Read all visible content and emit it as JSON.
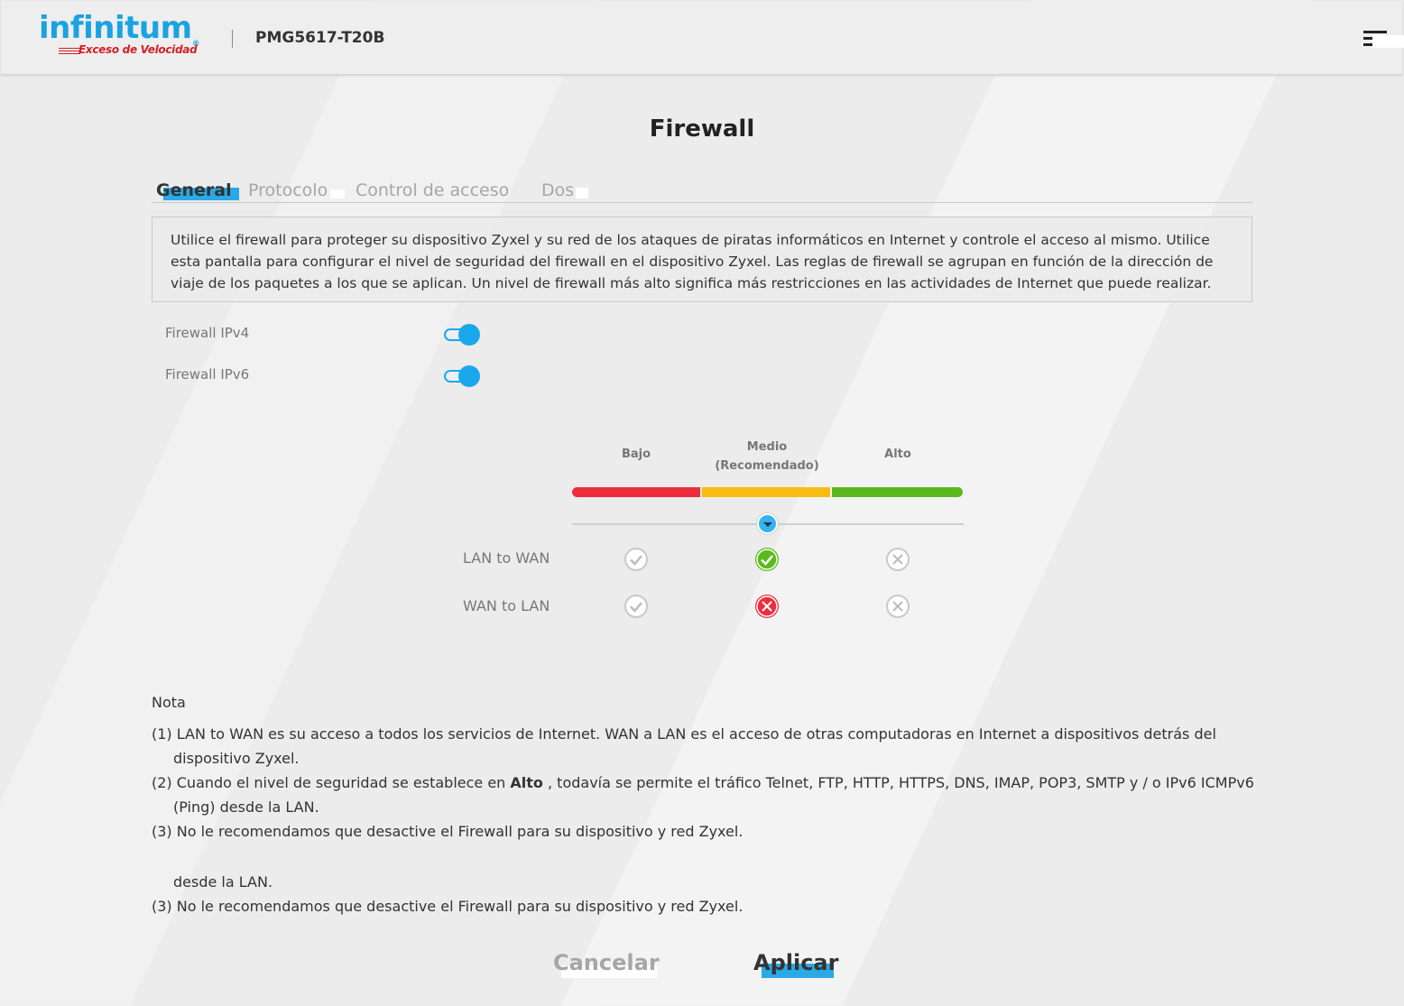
{
  "header": {
    "logo_main": "infinitum",
    "logo_reg": "®",
    "logo_sub": "Exceso de Velocidad",
    "model": "PMG5617-T20B"
  },
  "page": {
    "title": "Firewall"
  },
  "tabs": [
    {
      "label": "General",
      "active": true
    },
    {
      "label": "Protocolo",
      "active": false
    },
    {
      "label": "Control de acceso",
      "active": false
    },
    {
      "label": "Dos",
      "active": false
    }
  ],
  "description": "Utilice el firewall para proteger su dispositivo Zyxel y su red de los ataques de piratas informáticos en Internet y controle el acceso al mismo. Utilice esta pantalla para configurar el nivel de seguridad del firewall en el dispositivo Zyxel. Las reglas de firewall se agrupan en función de la dirección de viaje de los paquetes a los que se aplican. Un nivel de firewall más alto significa más restricciones en las actividades de Internet que puede realizar.",
  "firewall": {
    "ipv4": {
      "label": "Firewall IPv4",
      "enabled": true
    },
    "ipv6": {
      "label": "Firewall IPv6",
      "enabled": true
    }
  },
  "levels": {
    "low": "Bajo",
    "medium_line1": "Medio",
    "medium_line2": "(Recomendado)",
    "high": "Alto",
    "selected": "Medio",
    "colors": {
      "low": "#ee2d3c",
      "medium": "#f7bc13",
      "high": "#5cb91d",
      "accent": "#1aa8ec"
    }
  },
  "matrix": {
    "lan_to_wan": {
      "label": "LAN to WAN",
      "low": "check-gray",
      "medium": "check-green",
      "high": "x-gray"
    },
    "wan_to_lan": {
      "label": "WAN to LAN",
      "low": "check-gray",
      "medium": "x-red",
      "high": "x-gray"
    }
  },
  "notes": {
    "title": "Nota",
    "n1": "(1) LAN to WAN es su acceso a todos los servicios de Internet. WAN a LAN es el acceso de otras computadoras en Internet a dispositivos detrás del dispositivo Zyxel.",
    "n2_pre": "(2) Cuando el nivel de seguridad se establece en ",
    "n2_bold": "Alto",
    "n2_post": " , todavía se permite el tráfico Telnet, FTP, HTTP, HTTPS, DNS, IMAP, POP3, SMTP y / o IPv6 ICMPv6 (Ping) desde la LAN.",
    "n3": "(3) No le recomendamos que desactive el Firewall para su dispositivo y red Zyxel.",
    "n2_tail_repeat": "desde la LAN.",
    "n3_repeat": "(3) No le recomendamos que desactive el Firewall para su dispositivo y red Zyxel."
  },
  "buttons": {
    "cancel": "Cancelar",
    "apply": "Aplicar"
  }
}
